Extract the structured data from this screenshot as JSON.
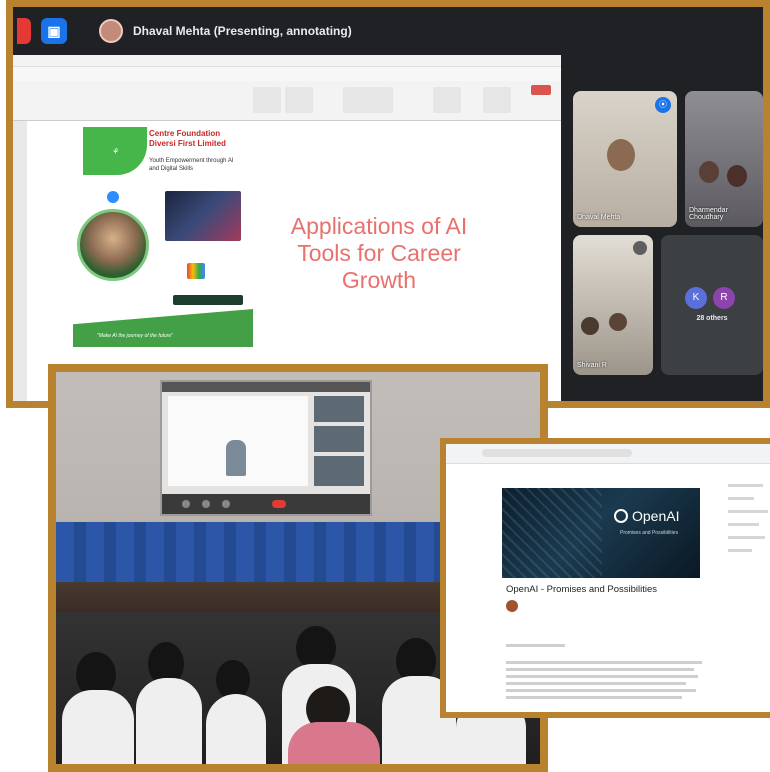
{
  "meeting": {
    "presenter_status": "Dhaval Mehta (Presenting, annotating)",
    "participants": [
      {
        "name": "Dhaval Mehta",
        "speaking": true
      },
      {
        "name": "Dharmendar Choudhary",
        "speaking": false
      },
      {
        "name": "Shivani R",
        "speaking": false
      }
    ],
    "others_avatars": [
      "K",
      "R"
    ],
    "others_label": "28 others"
  },
  "slide": {
    "title": "Applications of AI Tools for Career Growth",
    "poster": {
      "org_name": "Centre Foundation\nDiversi First Limited",
      "tagline": "Youth Empowerment through AI\nand Digital Skills",
      "motto": "\"Make AI the journey of the future\""
    }
  },
  "document": {
    "banner_brand": "OpenAI",
    "banner_subtitle": "Promises and Possibilities",
    "title": "OpenAI - Promises and Possibilities"
  },
  "colors": {
    "frame_gold": "#b8822e",
    "slide_title": "#e8716d",
    "meet_bg": "#202124",
    "speaking_blue": "#1a73e8",
    "avatar_k": "#5b6fd8",
    "avatar_r": "#8e44ad"
  },
  "icons": [
    "record-icon",
    "present-icon",
    "audio-wave-icon",
    "mute-icon",
    "openai-logo-icon"
  ]
}
